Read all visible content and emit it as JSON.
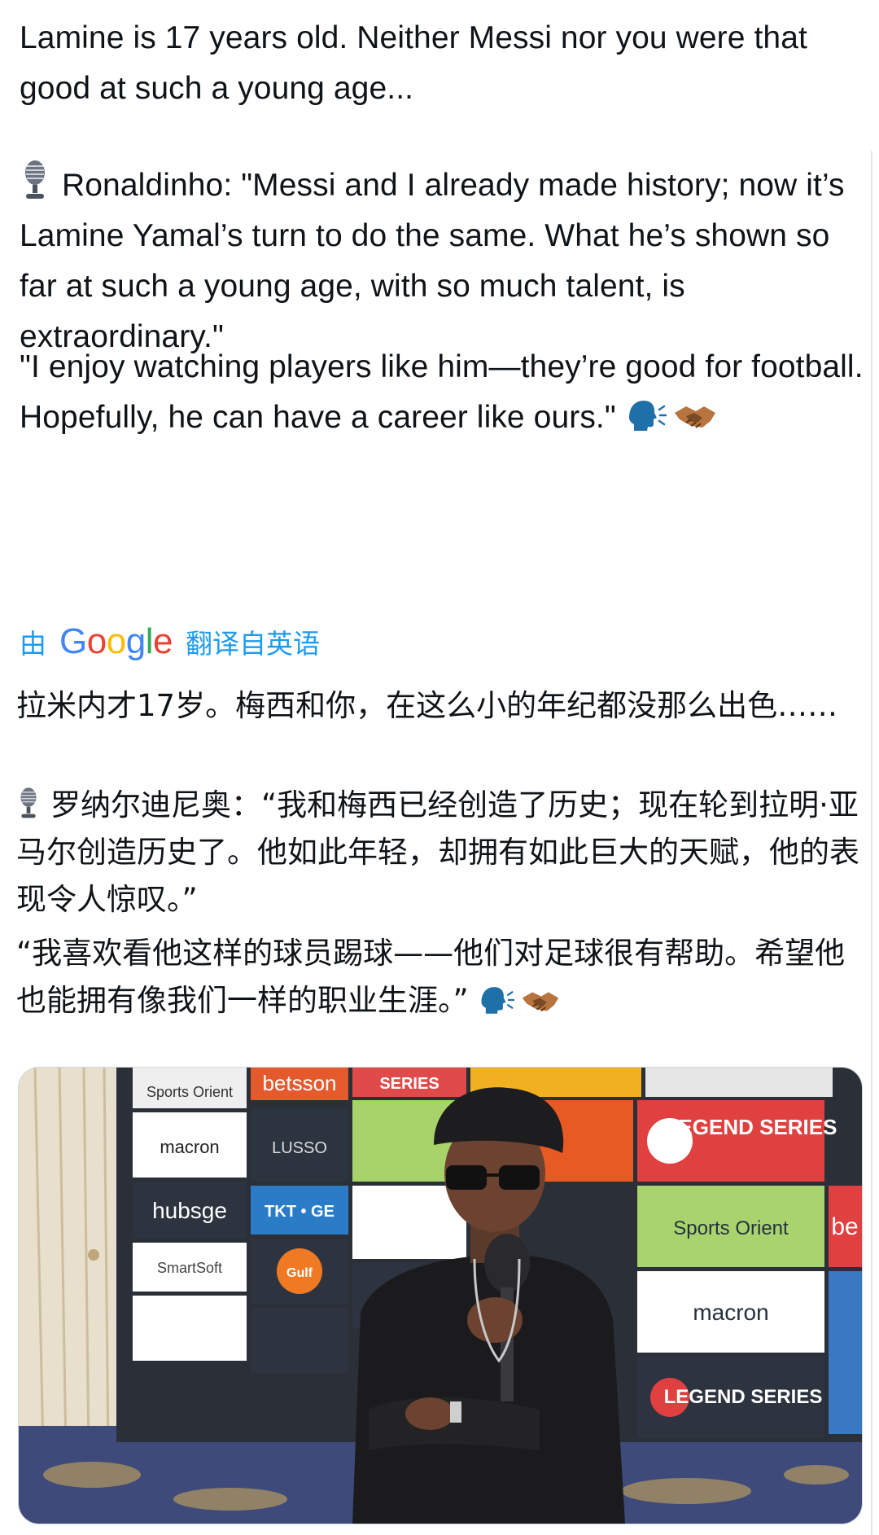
{
  "tweet": {
    "original": {
      "p1": "Lamine is 17 years old. Neither Messi nor you were that good at such a young age...",
      "p2": "Ronaldinho: \"Messi and I already made history; now it’s Lamine Yamal’s turn to do the same. What he’s shown so far at such a young age, with so much talent, is extraordinary.\"",
      "p3": "\"I enjoy watching players like him—they’re good for football. Hopefully, he can have a career like ours.\""
    },
    "translation_bar": {
      "prefix": "由",
      "brand": "Google",
      "suffix": "翻译自英语"
    },
    "translated": {
      "p1": "拉米内才17岁。梅西和你，在这么小的年纪都没那么出色……",
      "p2": "罗纳尔迪尼奥：“我和梅西已经创造了历史；现在轮到拉明·亚马尔创造历史了。他如此年轻，却拥有如此巨大的天赋，他的表现令人惊叹。”",
      "p3": "“我喜欢看他这样的球员踢球——他们对足球很有帮助。希望他也能拥有像我们一样的职业生涯。”"
    },
    "media": {
      "sponsor_texts": [
        "Sports Orient",
        "betsson",
        "SERIES",
        "macron",
        "LUSSO",
        "hubsge",
        "TKT • GE",
        "SmartSoft",
        "Gulf",
        "LEGEND SERIES",
        "Sports Orient",
        "macron",
        "LEGEND SERIES",
        "be"
      ]
    }
  },
  "colors": {
    "text": "#0f1419",
    "link_blue": "#1d9bf0",
    "google_blue": "#4285f4",
    "google_red": "#ea4335",
    "google_yellow": "#fbbc05",
    "google_green": "#34a853"
  },
  "icons": [
    "studio-microphone-icon",
    "speaking-head-icon",
    "handshake-icon"
  ]
}
